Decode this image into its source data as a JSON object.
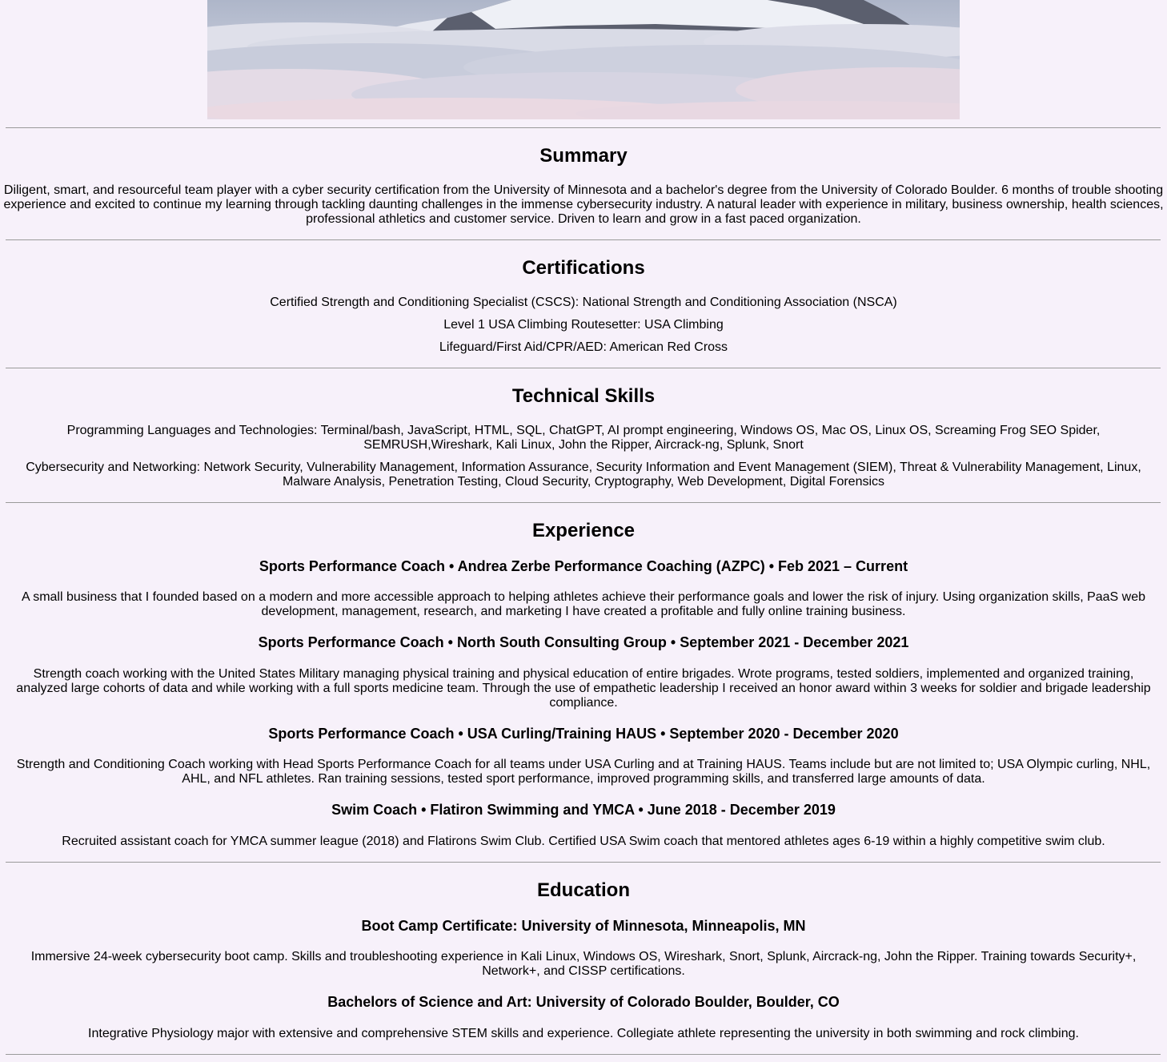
{
  "summary": {
    "heading": "Summary",
    "text": "Diligent, smart, and resourceful team player with a cyber security certification from the University of Minnesota and a bachelor's degree from the University of Colorado Boulder. 6 months of trouble shooting experience and excited to continue my learning through tackling daunting challenges in the immense cybersecurity industry. A natural leader with experience in military, business ownership, health sciences, professional athletics and customer service. Driven to learn and grow in a fast paced organization."
  },
  "certifications": {
    "heading": "Certifications",
    "items": [
      "Certified Strength and Conditioning Specialist (CSCS): National Strength and Conditioning Association (NSCA)",
      "Level 1 USA Climbing Routesetter: USA Climbing",
      "Lifeguard/First Aid/CPR/AED: American Red Cross"
    ]
  },
  "skills": {
    "heading": "Technical Skills",
    "items": [
      "Programming Languages and Technologies: Terminal/bash, JavaScript, HTML, SQL, ChatGPT, AI prompt engineering, Windows OS, Mac OS, Linux OS, Screaming Frog SEO Spider, SEMRUSH,Wireshark, Kali Linux, John the Ripper, Aircrack-ng, Splunk, Snort",
      "Cybersecurity and Networking: Network Security, Vulnerability Management, Information Assurance, Security Information and Event Management (SIEM), Threat & Vulnerability Management, Linux, Malware Analysis, Penetration Testing, Cloud Security, Cryptography, Web Development, Digital Forensics"
    ]
  },
  "experience": {
    "heading": "Experience",
    "jobs": [
      {
        "title": "Sports Performance Coach • Andrea Zerbe Performance Coaching (AZPC) • Feb 2021 – Current",
        "description": "A small business that I founded based on a modern and more accessible approach to helping athletes achieve their performance goals and lower the risk of injury. Using organization skills, PaaS web development, management, research, and marketing I have created a profitable and fully online training business."
      },
      {
        "title": "Sports Performance Coach • North South Consulting Group • September 2021 - December 2021",
        "description": "Strength coach working with the United States Military managing physical training and physical education of entire brigades. Wrote programs, tested soldiers, implemented and organized training, analyzed large cohorts of data and while working with a full sports medicine team. Through the use of empathetic leadership I received an honor award within 3 weeks for soldier and brigade leadership compliance."
      },
      {
        "title": "Sports Performance Coach • USA Curling/Training HAUS • September 2020 - December 2020",
        "description": "Strength and Conditioning Coach working with Head Sports Performance Coach for all teams under USA Curling and at Training HAUS. Teams include but are not limited to; USA Olympic curling, NHL, AHL, and NFL athletes. Ran training sessions, tested sport performance, improved programming skills, and transferred large amounts of data."
      },
      {
        "title": "Swim Coach • Flatiron Swimming and YMCA • June 2018 - December 2019",
        "description": "Recruited assistant coach for YMCA summer league (2018) and Flatirons Swim Club. Certified USA Swim coach that mentored athletes ages 6-19 within a highly competitive swim club."
      }
    ]
  },
  "education": {
    "heading": "Education",
    "schools": [
      {
        "title": "Boot Camp Certificate: University of Minnesota, Minneapolis, MN",
        "description": "Immersive 24-week cybersecurity boot camp. Skills and troubleshooting experience in Kali Linux, Windows OS, Wireshark, Snort, Splunk, Aircrack-ng, John the Ripper. Training towards Security+, Network+, and CISSP certifications."
      },
      {
        "title": "Bachelors of Science and Art: University of Colorado Boulder, Boulder, CO",
        "description": "Integrative Physiology major with extensive and comprehensive STEM skills and experience. Collegiate athlete representing the university in both swimming and rock climbing."
      }
    ]
  }
}
